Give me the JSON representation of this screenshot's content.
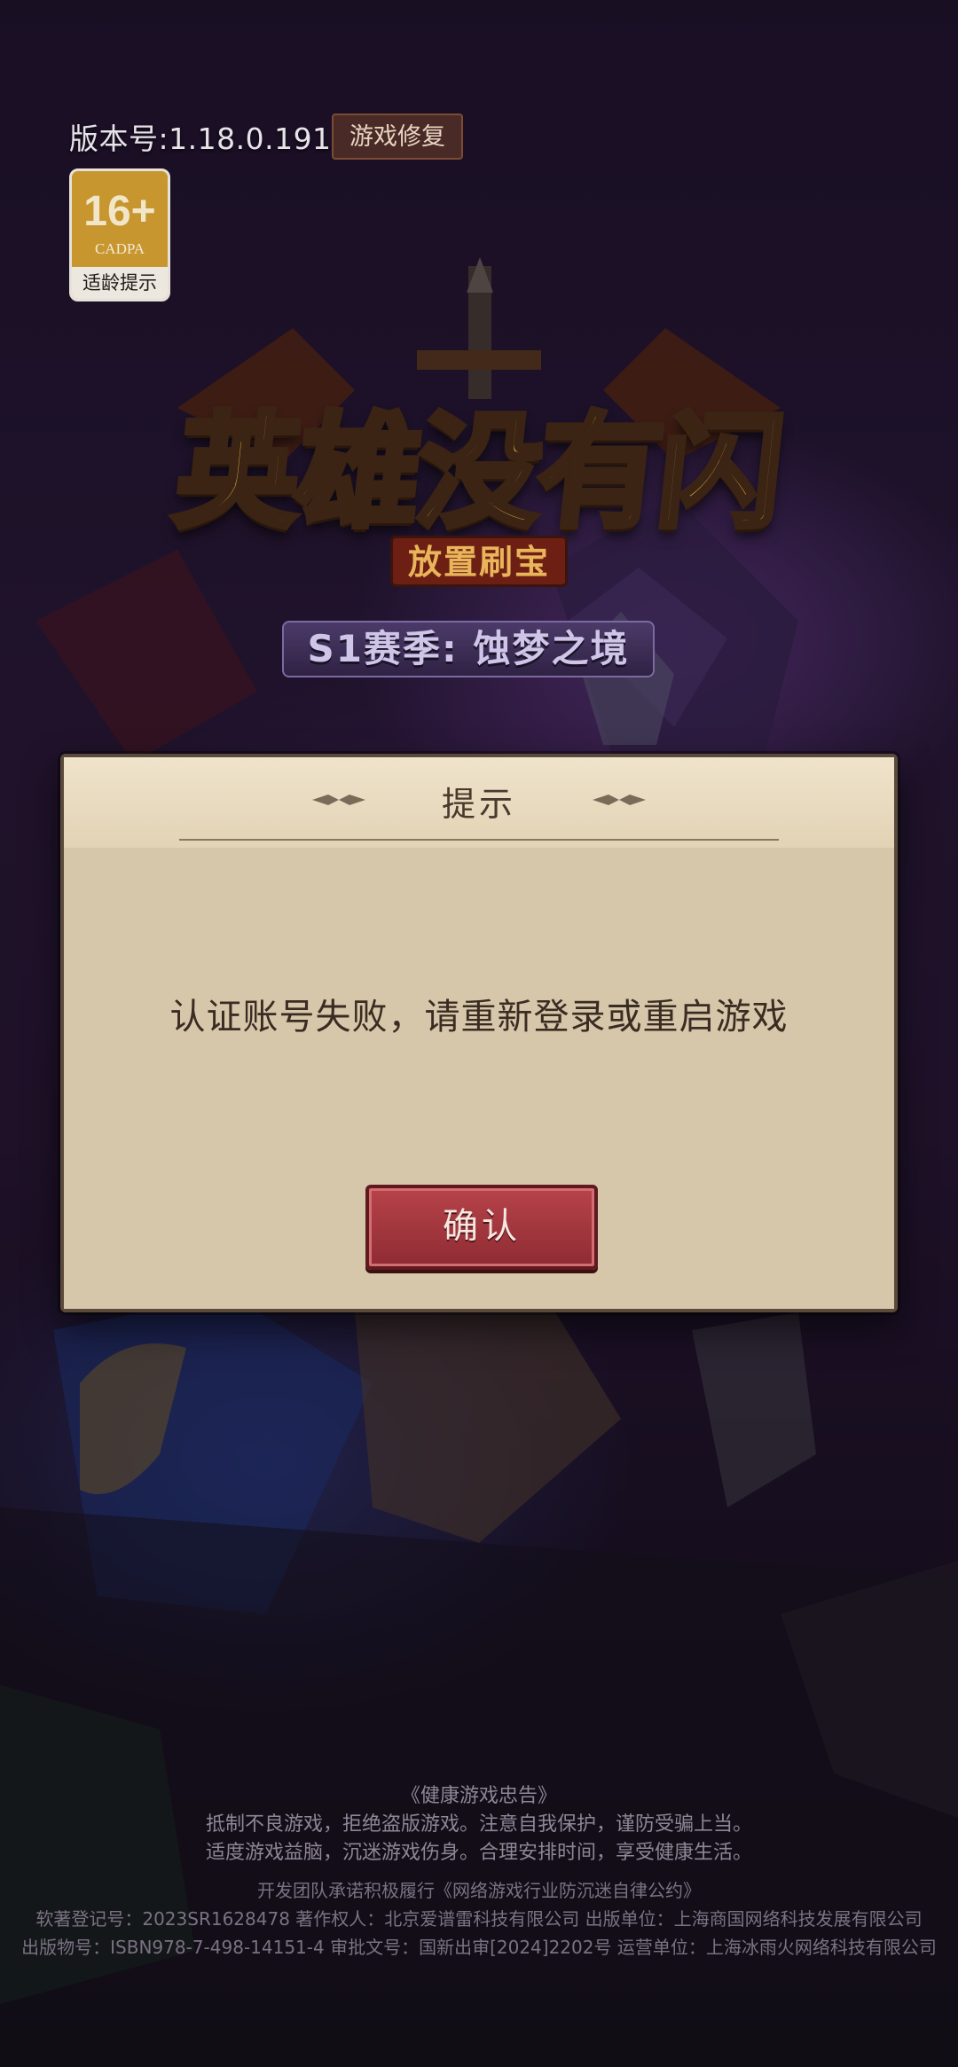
{
  "top": {
    "version_label": "版本号:1.18.0.191",
    "repair_button": "游戏修复"
  },
  "age_rating": {
    "number": "16+",
    "org": "CADPA",
    "tip": "适龄提示"
  },
  "logo": {
    "title": "英雄没有闪",
    "subtitle": "放置刷宝",
    "season": "S1赛季: 蚀梦之境"
  },
  "dialog": {
    "title": "提示",
    "message": "认证账号失败，请重新登录或重启游戏",
    "confirm_label": "确认"
  },
  "footer": {
    "notice_title": "《健康游戏忠告》",
    "notice_line1": "抵制不良游戏，拒绝盗版游戏。注意自我保护，谨防受骗上当。",
    "notice_line2": "适度游戏益脑，沉迷游戏伤身。合理安排时间，享受健康生活。",
    "pledge": "开发团队承诺积极履行《网络游戏行业防沉迷自律公约》",
    "copyright": "软著登记号：2023SR1628478  著作权人：北京爱谱雷科技有限公司  出版单位：上海商国网络科技发展有限公司",
    "publication": "出版物号：ISBN978-7-498-14151-4 审批文号：国新出审[2024]2202号 运营单位：上海冰雨火网络科技有限公司"
  }
}
